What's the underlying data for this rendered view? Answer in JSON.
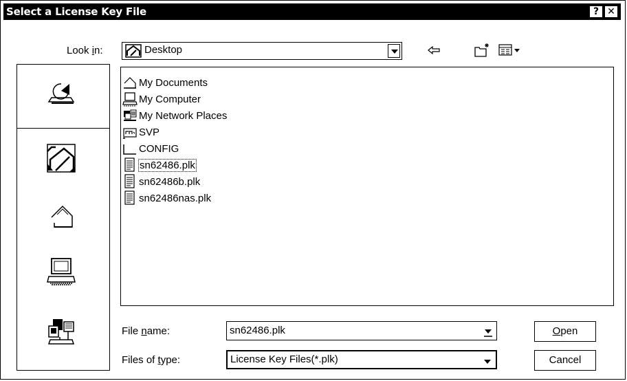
{
  "dialog": {
    "title": "Select a License Key File",
    "help_label": "?",
    "close_label": "✕"
  },
  "lookin": {
    "label": "Look in:",
    "label_pre": "Look ",
    "label_u": "i",
    "label_post": "n:",
    "value": "Desktop"
  },
  "toolbar": {
    "back_icon": "back-arrow-icon",
    "new_folder_icon": "new-folder-icon",
    "view_menu_icon": "view-menu-icon"
  },
  "places": [
    {
      "icon": "history-icon"
    },
    {
      "icon": "desktop-icon"
    },
    {
      "icon": "my-documents-icon"
    },
    {
      "icon": "my-computer-icon"
    },
    {
      "icon": "my-network-places-icon"
    }
  ],
  "files": [
    {
      "name": "My Documents",
      "icon": "my-documents-icon"
    },
    {
      "name": "My Computer",
      "icon": "my-computer-icon"
    },
    {
      "name": "My Network Places",
      "icon": "network-places-icon"
    },
    {
      "name": "SVP",
      "icon": "network-drive-icon"
    },
    {
      "name": "CONFIG",
      "icon": "folder-icon"
    },
    {
      "name": "sn62486.plk",
      "icon": "document-icon",
      "selected": true
    },
    {
      "name": "sn62486b.plk",
      "icon": "document-icon"
    },
    {
      "name": "sn62486nas.plk",
      "icon": "document-icon"
    }
  ],
  "filename": {
    "label_pre": "File ",
    "label_u": "n",
    "label_post": "ame:",
    "value": "sn62486.plk"
  },
  "filetype": {
    "label_pre": "Files of ",
    "label_u": "t",
    "label_post": "ype:",
    "value": "License Key Files(*.plk)"
  },
  "buttons": {
    "open_u": "O",
    "open_rest": "pen",
    "cancel": "Cancel"
  }
}
